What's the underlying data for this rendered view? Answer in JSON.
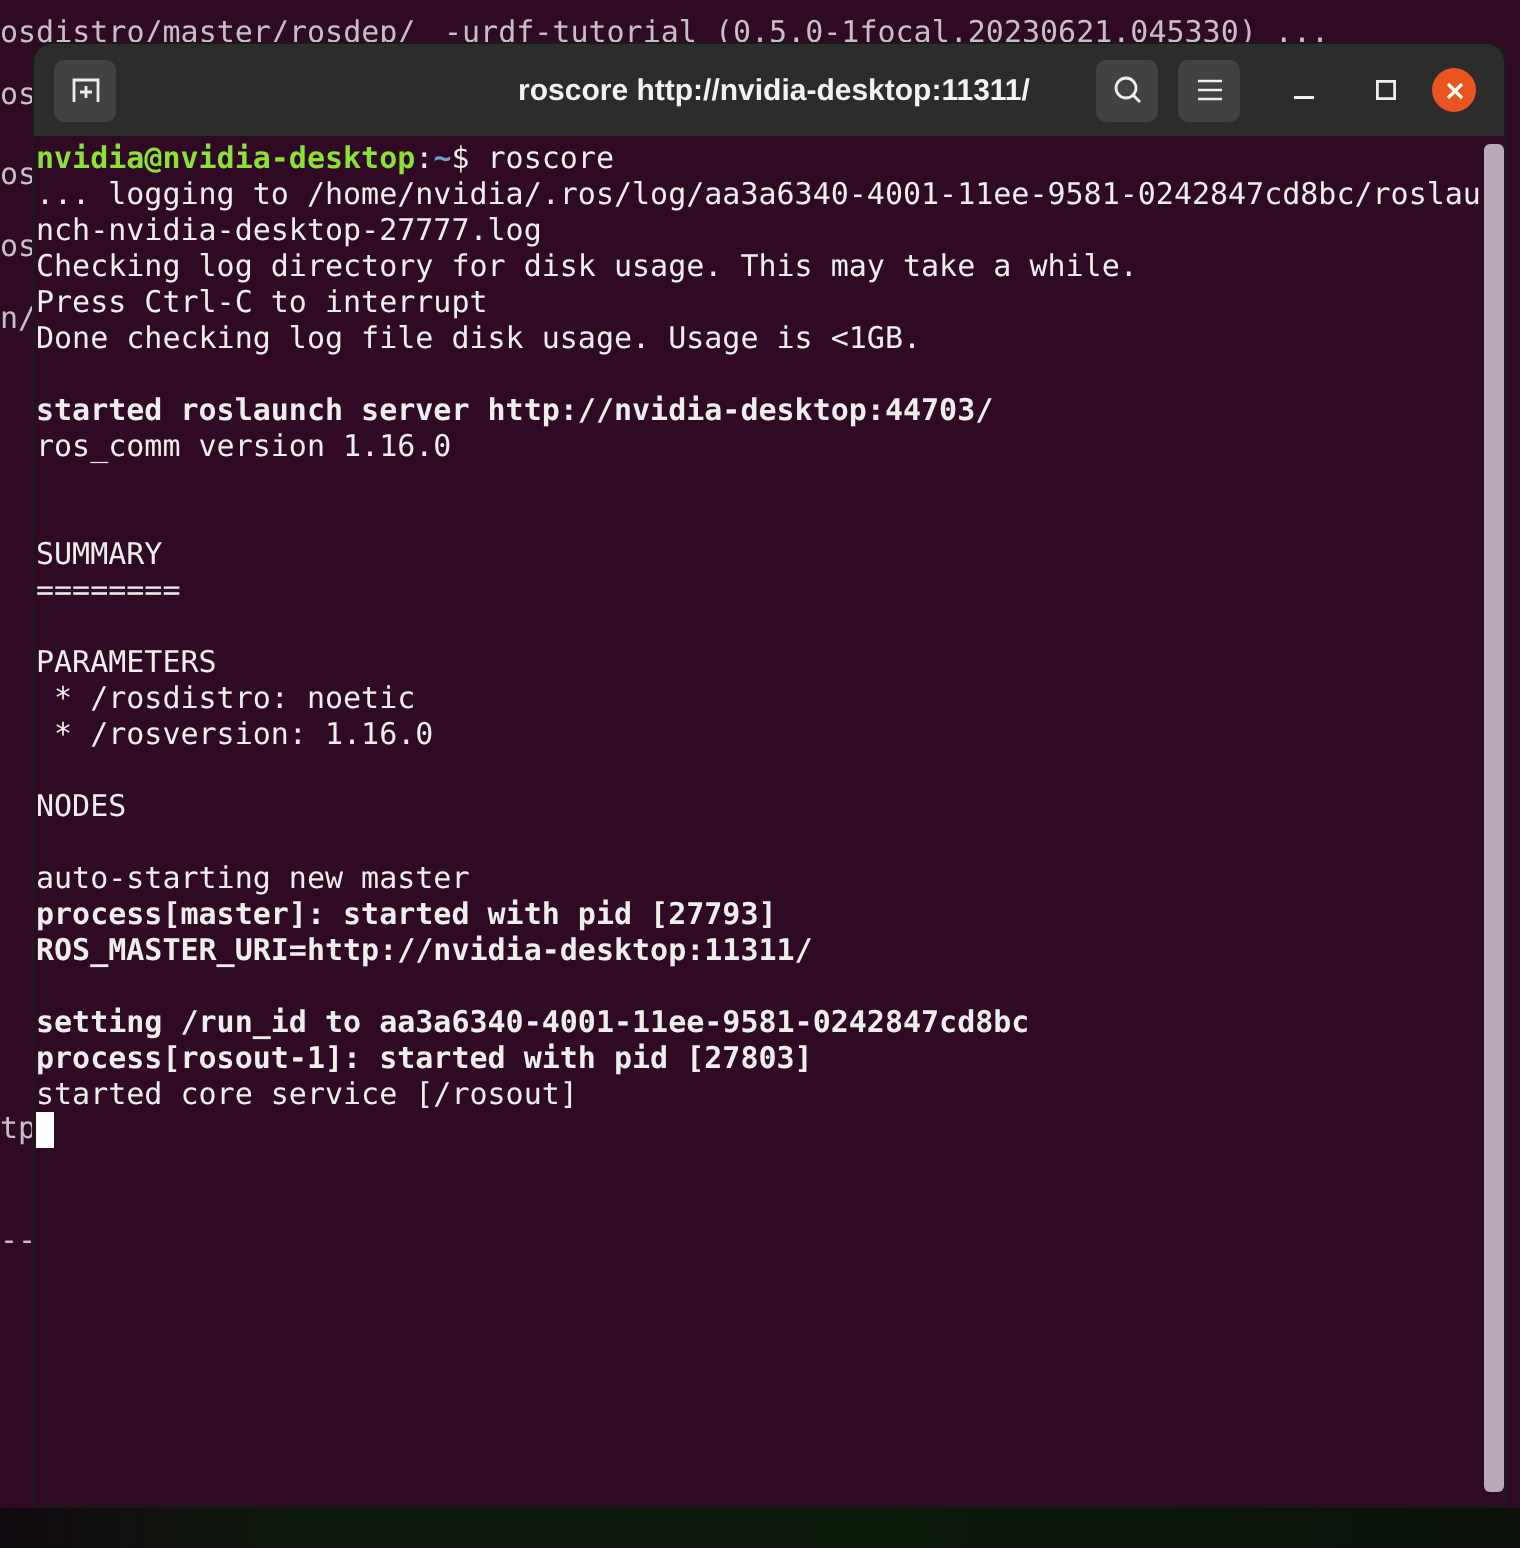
{
  "background_terminal": {
    "top_lines": [
      {
        "left": "osdistro/master/rosdep/",
        "right": "-urdf-tutorial (0.5.0-1focal.20230621.045330) ..."
      },
      {
        "left": "os"
      },
      {
        "left": "os"
      },
      {
        "left": "os"
      },
      {
        "left": "n/"
      }
    ],
    "bottom_lines": [
      "tp",
      "--"
    ]
  },
  "window": {
    "title": "roscore http://nvidia-desktop:11311/"
  },
  "terminal": {
    "lines": [
      {
        "kind": "prompt",
        "user_host": "nvidia@nvidia-desktop",
        "separator": ":",
        "path": "~",
        "symbol": "$",
        "command": "roscore"
      },
      {
        "kind": "text",
        "text": "... logging to /home/nvidia/.ros/log/aa3a6340-4001-11ee-9581-0242847cd8bc/roslau"
      },
      {
        "kind": "text",
        "text": "nch-nvidia-desktop-27777.log"
      },
      {
        "kind": "text",
        "text": "Checking log directory for disk usage. This may take a while."
      },
      {
        "kind": "text",
        "text": "Press Ctrl-C to interrupt"
      },
      {
        "kind": "text",
        "text": "Done checking log file disk usage. Usage is <1GB."
      },
      {
        "kind": "blank"
      },
      {
        "kind": "bold",
        "text": "started roslaunch server http://nvidia-desktop:44703/"
      },
      {
        "kind": "text",
        "text": "ros_comm version 1.16.0"
      },
      {
        "kind": "blank"
      },
      {
        "kind": "blank"
      },
      {
        "kind": "text",
        "text": "SUMMARY"
      },
      {
        "kind": "text",
        "text": "========"
      },
      {
        "kind": "blank"
      },
      {
        "kind": "text",
        "text": "PARAMETERS"
      },
      {
        "kind": "text",
        "text": " * /rosdistro: noetic"
      },
      {
        "kind": "text",
        "text": " * /rosversion: 1.16.0"
      },
      {
        "kind": "blank"
      },
      {
        "kind": "text",
        "text": "NODES"
      },
      {
        "kind": "blank"
      },
      {
        "kind": "text",
        "text": "auto-starting new master"
      },
      {
        "kind": "bold",
        "text": "process[master]: started with pid [27793]"
      },
      {
        "kind": "bold",
        "text": "ROS_MASTER_URI=http://nvidia-desktop:11311/"
      },
      {
        "kind": "blank"
      },
      {
        "kind": "bold",
        "text": "setting /run_id to aa3a6340-4001-11ee-9581-0242847cd8bc"
      },
      {
        "kind": "bold",
        "text": "process[rosout-1]: started with pid [27803]"
      },
      {
        "kind": "text",
        "text": "started core service [/rosout]"
      },
      {
        "kind": "cursor"
      }
    ]
  }
}
